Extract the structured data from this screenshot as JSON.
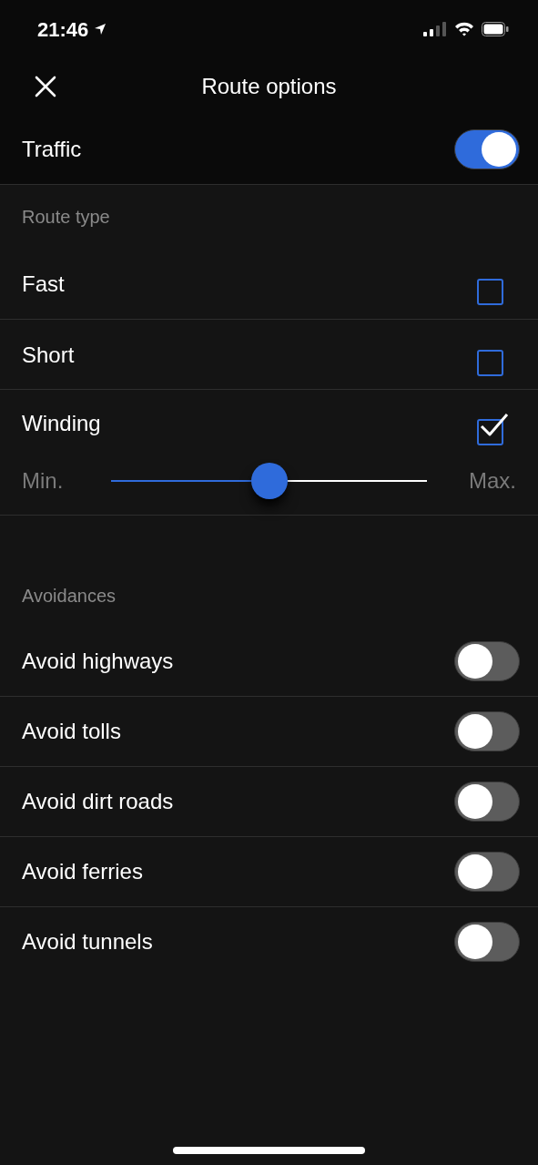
{
  "status_bar": {
    "time": "21:46"
  },
  "header": {
    "title": "Route options"
  },
  "traffic": {
    "label": "Traffic",
    "on": true
  },
  "route_type": {
    "heading": "Route type",
    "options": [
      {
        "label": "Fast",
        "checked": false
      },
      {
        "label": "Short",
        "checked": false
      },
      {
        "label": "Winding",
        "checked": true
      }
    ],
    "winding_slider": {
      "min_label": "Min.",
      "max_label": "Max.",
      "level": 0.5
    }
  },
  "avoidances": {
    "heading": "Avoidances",
    "items": [
      {
        "label": "Avoid highways",
        "on": false
      },
      {
        "label": "Avoid tolls",
        "on": false
      },
      {
        "label": "Avoid dirt roads",
        "on": false
      },
      {
        "label": "Avoid ferries",
        "on": false
      },
      {
        "label": "Avoid tunnels",
        "on": false
      }
    ]
  }
}
